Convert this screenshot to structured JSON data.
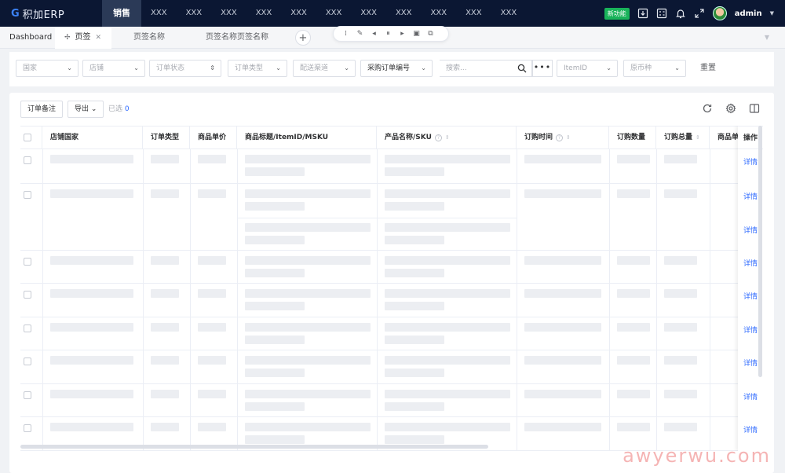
{
  "nav": {
    "logo_mark": "G",
    "logo_text": "积加ERP",
    "items": [
      {
        "label": "销售",
        "active": true
      },
      {
        "label": "XXX"
      },
      {
        "label": "XXX"
      },
      {
        "label": "XXX"
      },
      {
        "label": "XXX"
      },
      {
        "label": "XXX"
      },
      {
        "label": "XXX"
      },
      {
        "label": "XXX"
      },
      {
        "label": "XXX"
      },
      {
        "label": "XXX"
      },
      {
        "label": "XXX"
      },
      {
        "label": "XXX"
      }
    ],
    "new_feature": "新功能",
    "user": "admin"
  },
  "tabs": {
    "items": [
      {
        "label": "Dashboard"
      },
      {
        "label": "页签",
        "active": true
      },
      {
        "label": "页签名称"
      },
      {
        "label": "页签名称页签名称"
      }
    ],
    "add_label": "+"
  },
  "filters": {
    "country": "国家",
    "store": "店铺",
    "order_status": "订单状态",
    "order_type": "订单类型",
    "channel": "配送渠道",
    "search_field": "采购订单编号",
    "search_placeholder": "搜索...",
    "more": "•••",
    "item_id": "ItemID",
    "currency": "原币种",
    "reset": "重置"
  },
  "toolbar": {
    "note_button": "订单备注",
    "export_button": "导出",
    "selected_prefix": "已选",
    "selected_count": "0"
  },
  "table": {
    "columns": {
      "store_country": "店铺国家",
      "order_type": "订单类型",
      "unit_price": "商品单价",
      "title": "商品标题/ItemID/MSKU",
      "product": "产品名称/SKU",
      "order_time": "订购时间",
      "qty": "订购数量",
      "total": "订购总量",
      "product_unit": "商品单",
      "actions": "操作"
    },
    "detail_label": "详情"
  },
  "watermark": "awyerwu.com",
  "colors": {
    "accent": "#2f6bff",
    "nav_bg": "#0b1733",
    "new_badge": "#19b35a"
  }
}
